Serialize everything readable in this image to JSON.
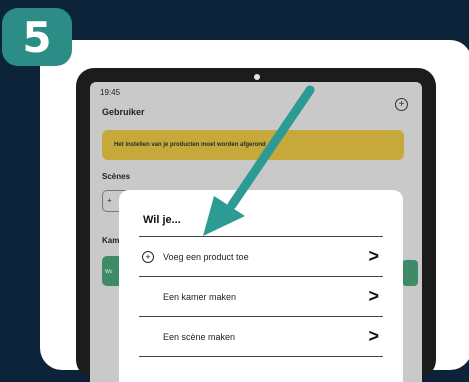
{
  "step": {
    "number": "5"
  },
  "status": {
    "time": "19:45"
  },
  "header": {
    "title": "Gebruiker",
    "add_icon": "+"
  },
  "notice": {
    "text": "Het instellen van je producten moet worden afgerond"
  },
  "scenes": {
    "heading": "Scènes",
    "chip_icon": "+"
  },
  "rooms": {
    "heading": "Kam",
    "tile_text": "Wo"
  },
  "sheet": {
    "title": "Wil je...",
    "items": [
      {
        "label": "Voeg een product toe",
        "icon": "plus-circle-icon",
        "arrow": ">"
      },
      {
        "label": "Een kamer maken",
        "arrow": ">"
      },
      {
        "label": "Een scène maken",
        "arrow": ">"
      }
    ]
  },
  "colors": {
    "background": "#0d2339",
    "accent": "#2c8d86",
    "notice": "#c6a93a",
    "room_tile": "#3f8b68"
  }
}
